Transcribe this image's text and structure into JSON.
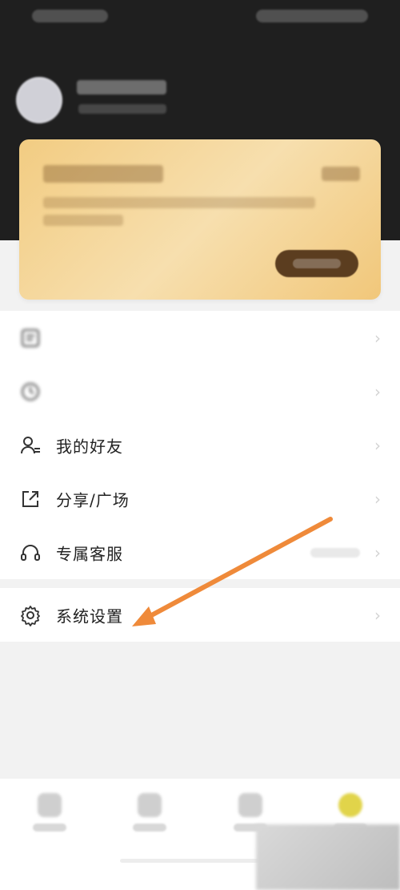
{
  "menu": {
    "items": [
      {
        "label": "",
        "icon": "record-icon"
      },
      {
        "label": "",
        "icon": "clock-icon"
      },
      {
        "label": "我的好友",
        "icon": "friends-icon"
      },
      {
        "label": "分享/广场",
        "icon": "share-icon"
      },
      {
        "label": "专属客服",
        "icon": "headset-icon"
      }
    ],
    "settings": {
      "label": "系统设置",
      "icon": "gear-icon"
    }
  },
  "annotation": {
    "color": "#ef8a3a"
  },
  "tabbar": {
    "active_color": "#e1d44a"
  }
}
